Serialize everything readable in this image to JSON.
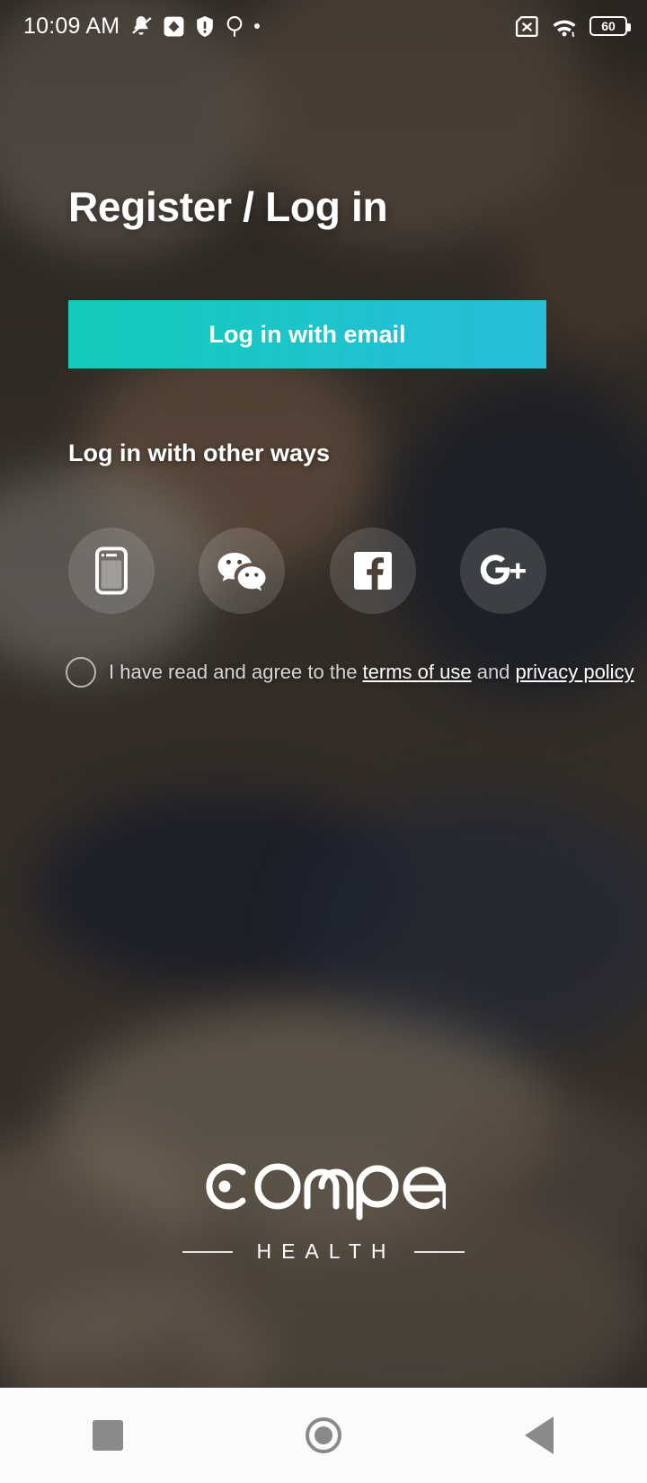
{
  "statusbar": {
    "time": "10:09 AM",
    "battery_level": "60",
    "icons_left": [
      "mute-bell-icon",
      "image-download-icon",
      "shield-warning-icon",
      "location-pin-icon",
      "small-dot-icon"
    ],
    "icons_right": [
      "no-sim-icon",
      "wifi-icon",
      "battery-icon"
    ]
  },
  "page": {
    "title": "Register / Log in"
  },
  "primary": {
    "email_login_label": "Log in with email",
    "gradient_start": "#12cbbb",
    "gradient_end": "#28bdd8"
  },
  "other_ways": {
    "heading": "Log in with other ways",
    "options": [
      {
        "name": "phone",
        "icon": "mobile-phone-icon"
      },
      {
        "name": "wechat",
        "icon": "wechat-icon"
      },
      {
        "name": "facebook",
        "icon": "facebook-icon"
      },
      {
        "name": "googleplus",
        "icon": "google-plus-icon"
      }
    ]
  },
  "terms": {
    "checked": false,
    "prefix": "I have read and agree to the ",
    "terms_link": "terms of use",
    "conjunction": " and ",
    "privacy_link": "privacy policy"
  },
  "branding": {
    "logo_wordmark": "comper",
    "logo_subtitle": "HEALTH"
  },
  "navbar": {
    "recents_label": "recents-button",
    "home_label": "home-button",
    "back_label": "back-button"
  }
}
